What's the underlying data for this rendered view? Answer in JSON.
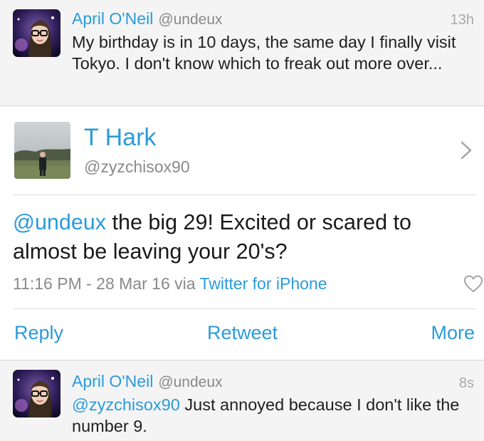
{
  "tweets": [
    {
      "name": "April O'Neil",
      "handle": "@undeux",
      "time": "13h",
      "text": "My birthday is in 10 days, the same day I finally visit Tokyo. I don't know which to freak out more over..."
    },
    {
      "name": "April O'Neil",
      "handle": "@undeux",
      "time": "8s",
      "mention": "@zyzchisox90",
      "text": " Just annoyed because I don't like the number 9."
    }
  ],
  "detail": {
    "name": "T Hark",
    "handle": "@zyzchisox90",
    "mention": "@undeux",
    "text": " the big 29! Excited or scared to almost be leaving your 20's?",
    "timestamp": "11:16 PM - 28 Mar 16 via ",
    "source": "Twitter for iPhone",
    "actions": {
      "reply": "Reply",
      "retweet": "Retweet",
      "more": "More"
    }
  },
  "colors": {
    "link": "#2b9bd9",
    "muted": "#8a8a8e",
    "compact_bg": "#f4f4f5",
    "detail_bg": "#ffffff"
  },
  "icons": {
    "detail_disclosure": "chevron-right-icon",
    "favorite": "heart-outline-icon"
  }
}
